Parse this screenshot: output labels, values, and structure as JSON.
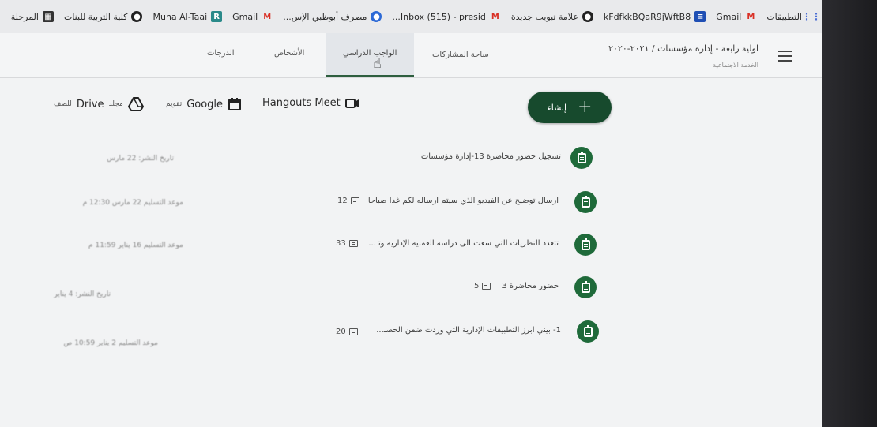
{
  "bookmarks": [
    {
      "icon": "apps-icon",
      "label": "التطبيقات"
    },
    {
      "icon": "gmail-icon",
      "label": "Gmail"
    },
    {
      "icon": "doc-icon",
      "label": "kFdfkkBQaR9jWftB8"
    },
    {
      "icon": "globe-icon",
      "label": "علامة تبويب جديدة"
    },
    {
      "icon": "gmail-icon",
      "label": "Inbox (515) - presid..."
    },
    {
      "icon": "globe-icon",
      "label": "مصرف أبوظبي الإس..."
    },
    {
      "icon": "gmail-icon",
      "label": "Gmail"
    },
    {
      "icon": "r-icon",
      "label": "Muna Al-Taai"
    },
    {
      "icon": "globe-icon",
      "label": "كلية التربية للبنات"
    },
    {
      "icon": "calendar-icon",
      "label": "المرحلة"
    }
  ],
  "header": {
    "class_title": "اولية رابعة - إدارة مؤسسات / ٢٠٢١-٢٠٢٠",
    "class_subtitle": "الخدمة الاجتماعية",
    "tabs": {
      "stream": "ساحة المشاركات",
      "classwork": "الواجب الدراسي",
      "people": "الأشخاص",
      "grades": "الدرجات"
    }
  },
  "toolbar": {
    "create_label": "إنشاء",
    "meet_label": "Hangouts Meet",
    "calendar_label": "Google",
    "calendar_prefix": "تقويم",
    "drive_label": "Drive",
    "drive_prefix": "مجلد",
    "drive_suffix": "للصف"
  },
  "items": [
    {
      "title": "تسجيل حضور محاضرة 13-إدارة مؤسسات",
      "comments": "",
      "meta": "تاريخ النشر: 22 مارس"
    },
    {
      "title": "ارسال توضيح عن الفيديو الذي سيتم ارساله لكم غدا صباحا",
      "comments": "12",
      "meta": "موعد التسليم 22 مارس 12:30 م"
    },
    {
      "title": "تتعدد النظريات التي سعت الى دراسة العملية الإدارية وتـ...",
      "comments": "33",
      "meta": "موعد التسليم 16 يناير 11:59 م"
    },
    {
      "title": "حضور محاضرة 3",
      "comments": "5",
      "meta": "تاريخ النشر: 4 يناير"
    },
    {
      "title": "1- بيني ابرز التطبيقات الإدارية التي وردت ضمن الحصـ...",
      "comments": "20",
      "meta": "موعد التسليم 2 يناير 10:59 ص"
    }
  ]
}
